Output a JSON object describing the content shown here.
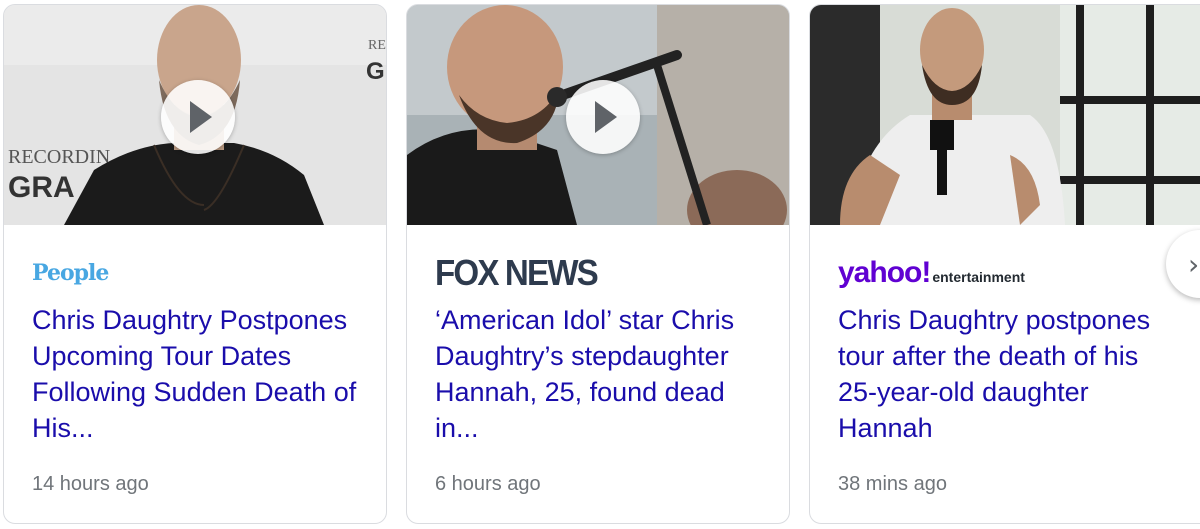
{
  "cards": [
    {
      "source": "People",
      "headline": "Chris Daughtry Postpones Upcoming Tour Dates Following Sudden Death of His...",
      "time": "14 hours ago",
      "thumb_text_1": "RECORDIN",
      "thumb_text_2": "GRA",
      "thumb_text_3": "RE",
      "thumb_text_4": "GI",
      "has_play": true
    },
    {
      "source": "FOX NEWS",
      "headline": "‘American Idol’ star Chris Daughtry’s stepdaughter Hannah, 25, found dead in...",
      "time": "6 hours ago",
      "has_play": true
    },
    {
      "source_main": "yahoo!",
      "source_sub": "entertainment",
      "headline": "Chris Daughtry postpones tour after the death of his 25-year-old daughter Hannah",
      "time": "38 mins ago",
      "has_play": false
    }
  ],
  "next_icon": "chevron-right-icon",
  "colors": {
    "headline": "#1a0dab",
    "time": "#70757a",
    "people": "#48a7e2",
    "fox": "#2e3b4e",
    "yahoo": "#6001d2"
  }
}
